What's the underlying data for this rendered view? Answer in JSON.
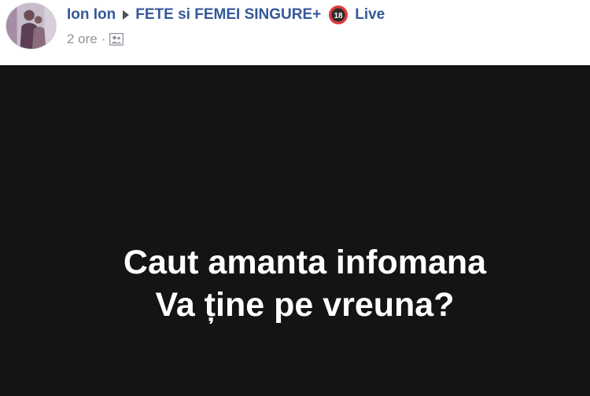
{
  "header": {
    "author": "Ion Ion",
    "group": "FETE si FEMEI SINGURE+",
    "badge": "18",
    "activity": "Live",
    "time": "2 ore",
    "separator": "·"
  },
  "post": {
    "line1": "Caut amanta infomana",
    "line2": "Va ține pe vreuna?",
    "background_color": "#141416",
    "text_color": "#ffffff"
  },
  "colors": {
    "link": "#365899",
    "meta": "#90949c",
    "badge": "#e0393e"
  },
  "icons": {
    "arrow": "triangle-right-icon",
    "badge": "adult-18-badge-icon",
    "audience": "group-audience-icon"
  }
}
